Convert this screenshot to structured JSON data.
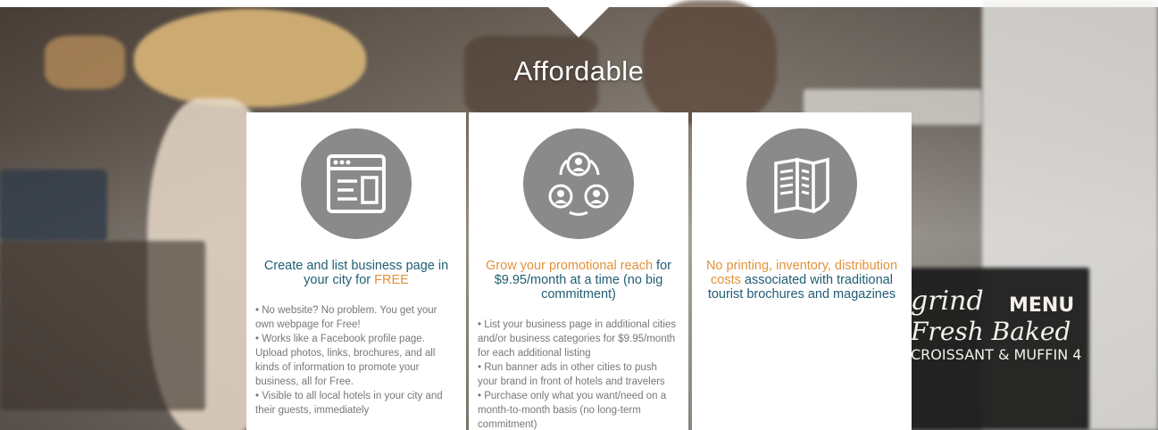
{
  "title": "Affordable",
  "colors": {
    "teal": "#1f5d73",
    "orange": "#e3923b",
    "icon_circle": "#8a8a8a"
  },
  "cards": [
    {
      "icon": "webpage-icon",
      "heading_pre": "Create and list business page in your city for ",
      "heading_highlight": "FREE",
      "bullets": [
        "• No website? No problem. You get your own webpage for Free!",
        "• Works like a Facebook profile page. Upload photos, links, brochures, and all kinds of information to promote your business, all for Free.",
        "• Visible to all local hotels in your city and their guests, immediately"
      ]
    },
    {
      "icon": "network-users-icon",
      "heading_highlight": "Grow your promotional reach",
      "heading_post": " for $9.95/month at a time (no big commitment)",
      "bullets": [
        "• List your business page in additional cities and/or business categories for $9.95/month for each additional listing",
        "• Run banner ads in other cities to push your brand in front of hotels and travelers",
        "• Purchase only what you want/need on a month-to-month basis (no long-term commitment)"
      ]
    },
    {
      "icon": "brochure-icon",
      "heading_highlight": "No printing, inventory, distribution costs",
      "heading_post": " associated with traditional tourist brochures and magazines"
    }
  ],
  "background_sign": {
    "line1": "grind",
    "line2": "MENU",
    "line3": "Fresh Baked",
    "line4": "CROISSANT & MUFFIN 4"
  }
}
